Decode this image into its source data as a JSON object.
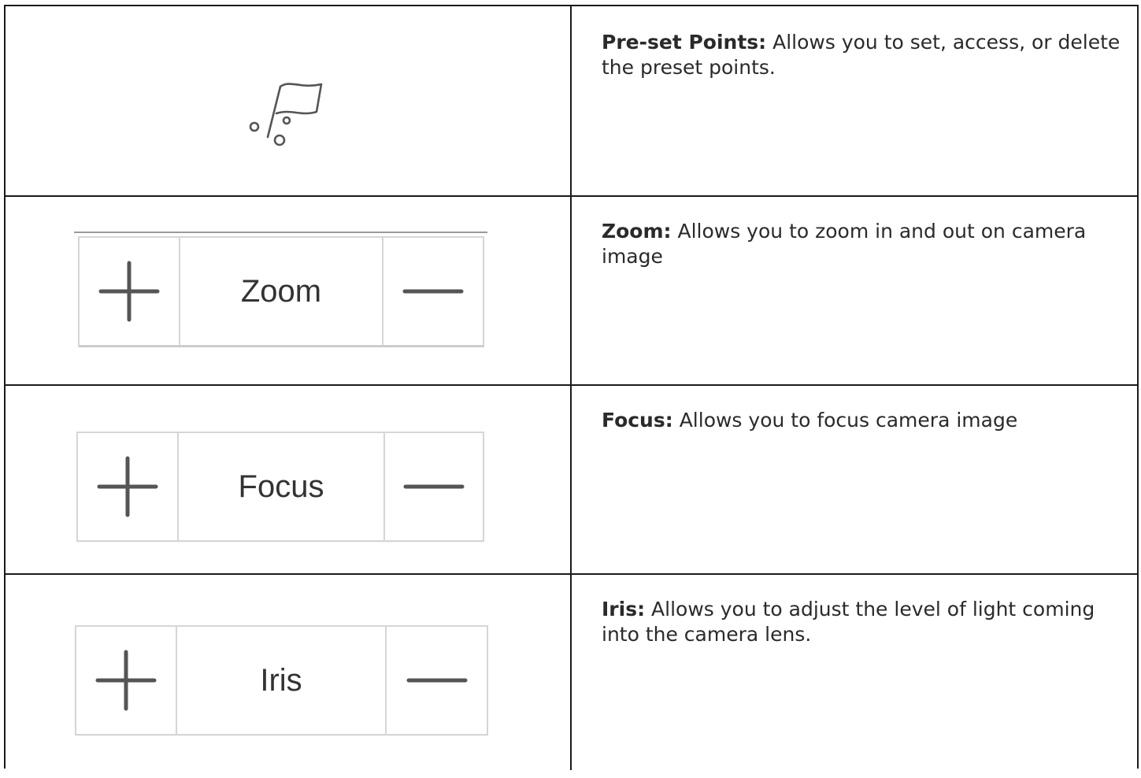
{
  "rows": [
    {
      "control": null,
      "icon": "preset-flag-icon",
      "title": "Pre-set Points:",
      "description": " Allows you to set, access, or delete the preset points."
    },
    {
      "control": {
        "label": "Zoom",
        "increase_icon": "plus-icon",
        "decrease_icon": "minus-icon"
      },
      "title": "Zoom:",
      "description": " Allows you to zoom in and out on camera image"
    },
    {
      "control": {
        "label": "Focus",
        "increase_icon": "plus-icon",
        "decrease_icon": "minus-icon"
      },
      "title": "Focus:",
      "description": " Allows you to focus camera image"
    },
    {
      "control": {
        "label": "Iris",
        "increase_icon": "plus-icon",
        "decrease_icon": "minus-icon"
      },
      "title": "Iris:",
      "description": " Allows you to adjust the level of light coming into the camera lens."
    }
  ],
  "colors": {
    "border": "#1a1a1a",
    "control_border": "#d6d6d6",
    "icon_stroke": "#555555",
    "text": "#2a2a2a"
  }
}
